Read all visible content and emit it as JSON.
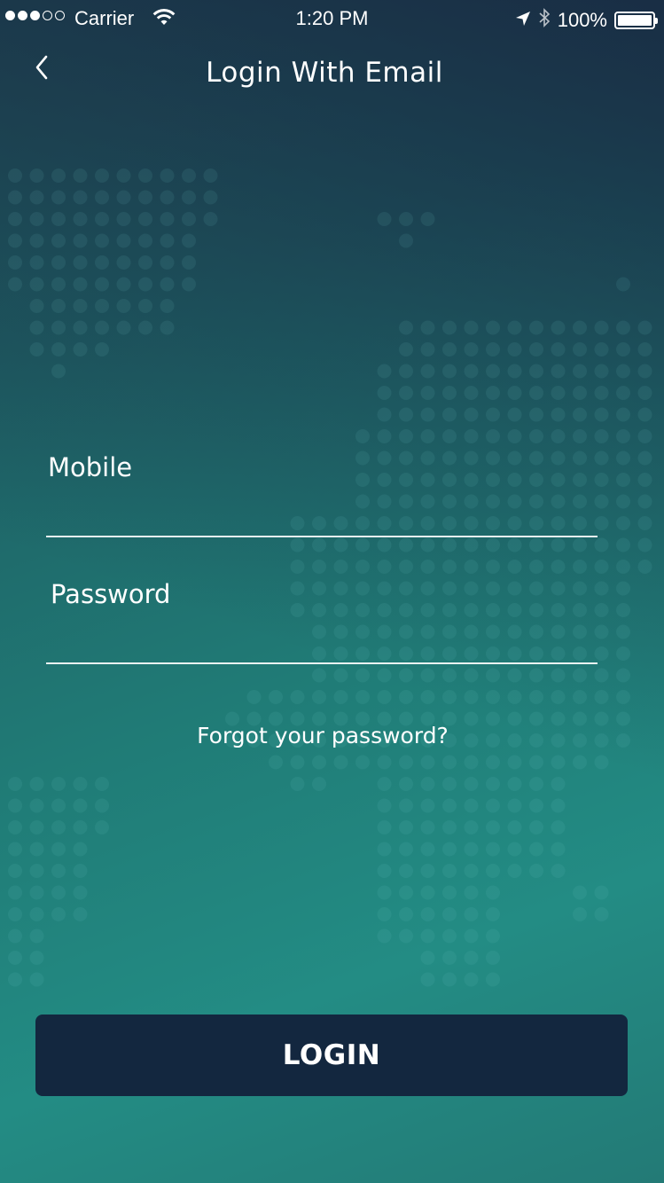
{
  "status_bar": {
    "carrier": "Carrier",
    "time": "1:20 PM",
    "battery": "100%",
    "signal_bars_filled": 3,
    "signal_bars_total": 5,
    "battery_level": 1.0,
    "icons": [
      "wifi-icon",
      "location-arrow-icon",
      "bluetooth-icon",
      "battery-icon"
    ]
  },
  "nav": {
    "back_icon": "chevron-left-icon",
    "title": "Login With Email"
  },
  "form": {
    "mobile": {
      "label": "Mobile",
      "value": "",
      "placeholder": ""
    },
    "password": {
      "label": "Password",
      "value": "",
      "placeholder": ""
    },
    "forgot_link": "Forgot your password?"
  },
  "actions": {
    "login_label": "LOGIN"
  },
  "colors": {
    "background_top": "#1b3345",
    "background_bottom": "#238c84",
    "button": "#13273f",
    "text": "#ffffff"
  }
}
